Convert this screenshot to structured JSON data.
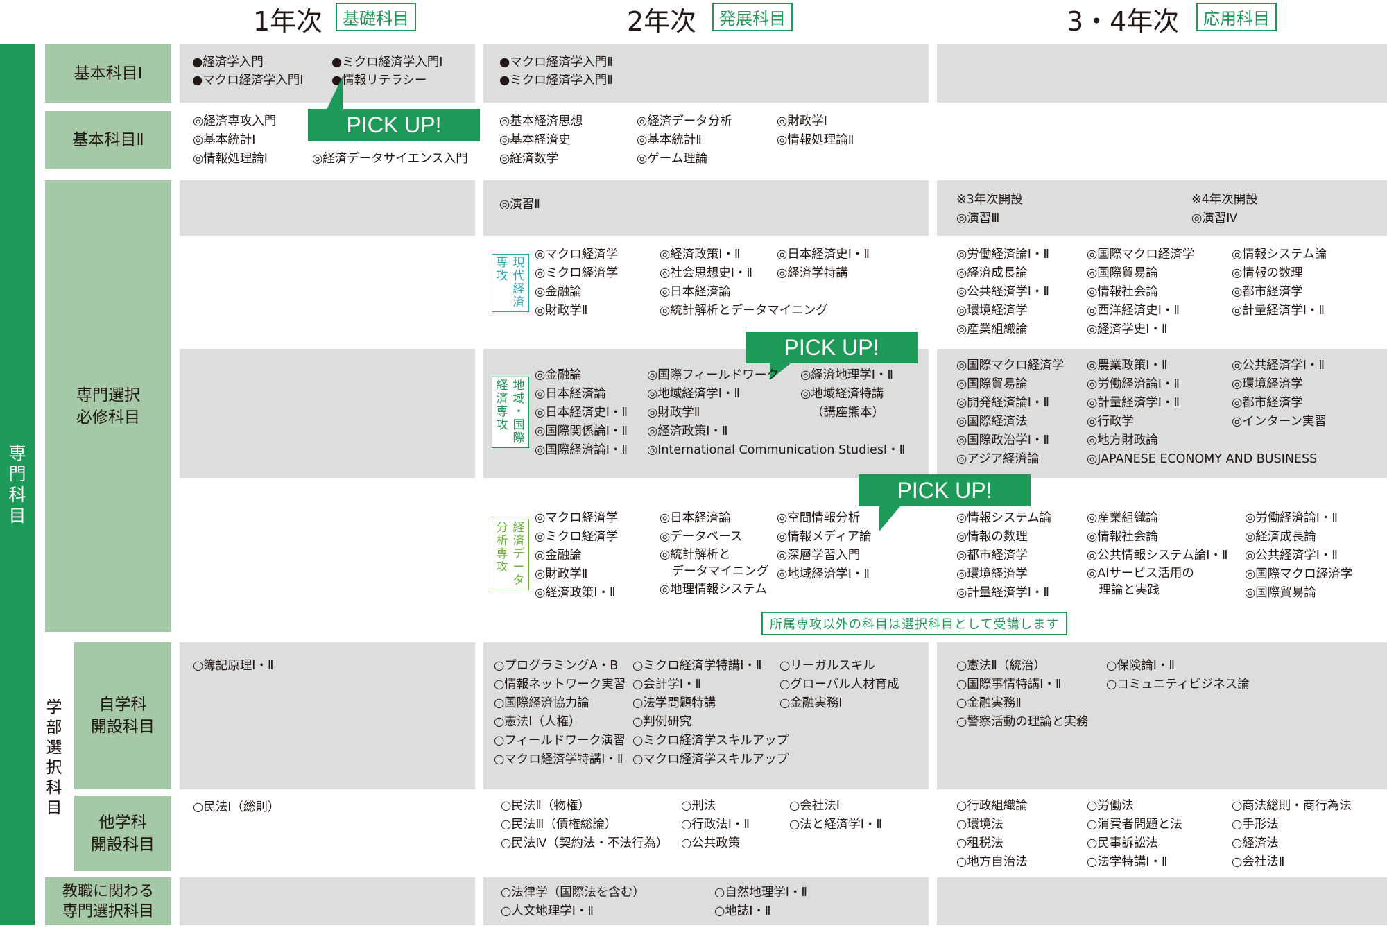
{
  "headers": {
    "year1": {
      "label": "1年次",
      "tag": "基礎科目"
    },
    "year2": {
      "label": "2年次",
      "tag": "発展科目"
    },
    "year34": {
      "label": "3・4年次",
      "tag": "応用科目"
    }
  },
  "side": {
    "senmon": [
      "専",
      "門",
      "科",
      "目"
    ],
    "gakubu": [
      "学",
      "部",
      "選",
      "択",
      "科",
      "目"
    ]
  },
  "row_labels": {
    "kihon1": "基本科目Ⅰ",
    "kihon2": "基本科目Ⅱ",
    "senmon_sentaku": "専門選択\n必修科目",
    "jigakka": "自学科\n開設科目",
    "tagakka": "他学科\n開設科目",
    "kyoshoku": "教職に関わる\n専門選択科目"
  },
  "pickup_label": "PICK UP!",
  "kihon1": {
    "y1": [
      "●経済学入門",
      "●ミクロ経済学入門Ⅰ",
      "●マクロ経済学入門Ⅰ",
      "●情報リテラシー"
    ],
    "y2": [
      "●マクロ経済学入門Ⅱ",
      "●ミクロ経済学入門Ⅱ"
    ]
  },
  "kihon2": {
    "y1": [
      "◎経済専攻入門",
      "◎基本統計Ⅰ",
      "◎情報処理論Ⅰ",
      "◎経済データサイエンス入門"
    ],
    "y2": [
      "◎基本経済思想",
      "◎基本経済史",
      "◎経済数学",
      "◎経済データ分析",
      "◎基本統計Ⅱ",
      "◎ゲーム理論",
      "◎財政学Ⅰ",
      "◎情報処理論Ⅱ"
    ]
  },
  "enshu": {
    "y2": "◎演習Ⅱ",
    "y3_note": "※3年次開設",
    "y3": "◎演習Ⅲ",
    "y4_note": "※4年次開設",
    "y4": "◎演習Ⅳ"
  },
  "majors": {
    "gendai": {
      "name": [
        "専",
        "現",
        "攻",
        "代",
        "",
        "経",
        "",
        "済"
      ]
    },
    "chiiki": {
      "name": [
        "経",
        "地",
        "済",
        "域",
        "専",
        "・",
        "攻",
        "国",
        "",
        "際"
      ]
    },
    "data": {
      "name": [
        "分",
        "経",
        "析",
        "済",
        "専",
        "デ",
        "攻",
        "ー",
        "",
        "タ"
      ]
    }
  },
  "gendai": {
    "y2_col1": [
      "◎マクロ経済学",
      "◎ミクロ経済学",
      "◎金融論",
      "◎財政学Ⅱ"
    ],
    "y2_col2": [
      "◎経済政策Ⅰ・Ⅱ",
      "◎社会思想史Ⅰ・Ⅱ",
      "◎日本経済論",
      "◎統計解析とデータマイニング"
    ],
    "y2_col3": [
      "◎日本経済史Ⅰ・Ⅱ",
      "◎経済学特講"
    ],
    "y3_col1": [
      "◎労働経済論Ⅰ・Ⅱ",
      "◎経済成長論",
      "◎公共経済学Ⅰ・Ⅱ",
      "◎環境経済学",
      "◎産業組織論"
    ],
    "y3_col2": [
      "◎国際マクロ経済学",
      "◎国際貿易論",
      "◎情報社会論",
      "◎西洋経済史Ⅰ・Ⅱ",
      "◎経済学史Ⅰ・Ⅱ"
    ],
    "y3_col3": [
      "◎情報システム論",
      "◎情報の数理",
      "◎都市経済学",
      "◎計量経済学Ⅰ・Ⅱ"
    ]
  },
  "chiiki": {
    "y2_col1": [
      "◎金融論",
      "◎日本経済論",
      "◎日本経済史Ⅰ・Ⅱ",
      "◎国際関係論Ⅰ・Ⅱ",
      "◎国際経済論Ⅰ・Ⅱ"
    ],
    "y2_col2": [
      "◎国際フィールドワーク",
      "◎地域経済学Ⅰ・Ⅱ",
      "◎財政学Ⅱ",
      "◎経済政策Ⅰ・Ⅱ",
      "◎International Communication StudiesⅠ・Ⅱ"
    ],
    "y2_col3": [
      "◎経済地理学Ⅰ・Ⅱ",
      "◎地域経済特講",
      "（講座熊本）"
    ],
    "y3_col1": [
      "◎国際マクロ経済学",
      "◎国際貿易論",
      "◎開発経済論Ⅰ・Ⅱ",
      "◎国際経済法",
      "◎国際政治学Ⅰ・Ⅱ",
      "◎アジア経済論"
    ],
    "y3_col2": [
      "◎農業政策Ⅰ・Ⅱ",
      "◎労働経済論Ⅰ・Ⅱ",
      "◎計量経済学Ⅰ・Ⅱ",
      "◎行政学",
      "◎地方財政論",
      "◎JAPANESE ECONOMY AND BUSINESS"
    ],
    "y3_col3": [
      "◎公共経済学Ⅰ・Ⅱ",
      "◎環境経済学",
      "◎都市経済学",
      "◎インターン実習"
    ]
  },
  "data_major": {
    "y2_col1": [
      "◎マクロ経済学",
      "◎ミクロ経済学",
      "◎金融論",
      "◎財政学Ⅱ",
      "◎経済政策Ⅰ・Ⅱ"
    ],
    "y2_col2": [
      "◎日本経済論",
      "◎データベース",
      "◎統計解析と\n　データマイニング",
      "◎地理情報システム"
    ],
    "y2_col3": [
      "◎空間情報分析",
      "◎情報メディア論",
      "◎深層学習入門",
      "◎地域経済学Ⅰ・Ⅱ"
    ],
    "y3_col1": [
      "◎情報システム論",
      "◎情報の数理",
      "◎都市経済学",
      "◎環境経済学",
      "◎計量経済学Ⅰ・Ⅱ"
    ],
    "y3_col2": [
      "◎産業組織論",
      "◎情報社会論",
      "◎公共情報システム論Ⅰ・Ⅱ",
      "◎AIサービス活用の\n　理論と実践"
    ],
    "y3_col3": [
      "◎労働経済論Ⅰ・Ⅱ",
      "◎経済成長論",
      "◎公共経済学Ⅰ・Ⅱ",
      "◎国際マクロ経済学",
      "◎国際貿易論"
    ]
  },
  "note_other_major": "所属専攻以外の科目は選択科目として受講します",
  "jigakka": {
    "y1": [
      "○簿記原理Ⅰ・Ⅱ"
    ],
    "y2_col1": [
      "○プログラミングA・B",
      "○情報ネットワーク実習",
      "○国際経済協力論",
      "○憲法Ⅰ（人権）",
      "○フィールドワーク演習",
      "○マクロ経済学特講Ⅰ・Ⅱ"
    ],
    "y2_col2": [
      "○ミクロ経済学特講Ⅰ・Ⅱ",
      "○会計学Ⅰ・Ⅱ",
      "○法学問題特講",
      "○判例研究",
      "○ミクロ経済学スキルアップ",
      "○マクロ経済学スキルアップ"
    ],
    "y2_col3": [
      "○リーガルスキル",
      "○グローバル人材育成",
      "○金融実務Ⅰ"
    ],
    "y3_col1": [
      "○憲法Ⅱ（統治）",
      "○国際事情特講Ⅰ・Ⅱ",
      "○金融実務Ⅱ",
      "○警察活動の理論と実務"
    ],
    "y3_col2": [
      "○保険論Ⅰ・Ⅱ",
      "○コミュニティビジネス論"
    ]
  },
  "tagakka": {
    "y1": [
      "○民法Ⅰ（総則）"
    ],
    "y2_col1": [
      "○民法Ⅱ（物権）",
      "○民法Ⅲ（債権総論）",
      "○民法Ⅳ（契約法・不法行為）"
    ],
    "y2_col2": [
      "○刑法",
      "○行政法Ⅰ・Ⅱ",
      "○公共政策"
    ],
    "y2_col3": [
      "○会社法Ⅰ",
      "○法と経済学Ⅰ・Ⅱ"
    ],
    "y3_col1": [
      "○行政組織論",
      "○環境法",
      "○租税法",
      "○地方自治法"
    ],
    "y3_col2": [
      "○労働法",
      "○消費者問題と法",
      "○民事訴訟法",
      "○法学特講Ⅰ・Ⅱ"
    ],
    "y3_col3": [
      "○商法総則・商行為法",
      "○手形法",
      "○経済法",
      "○会社法Ⅱ"
    ]
  },
  "kyoshoku": {
    "y2_col1": [
      "○法律学（国際法を含む）",
      "○人文地理学Ⅰ・Ⅱ"
    ],
    "y2_col2": [
      "○自然地理学Ⅰ・Ⅱ",
      "○地誌Ⅰ・Ⅱ"
    ]
  }
}
